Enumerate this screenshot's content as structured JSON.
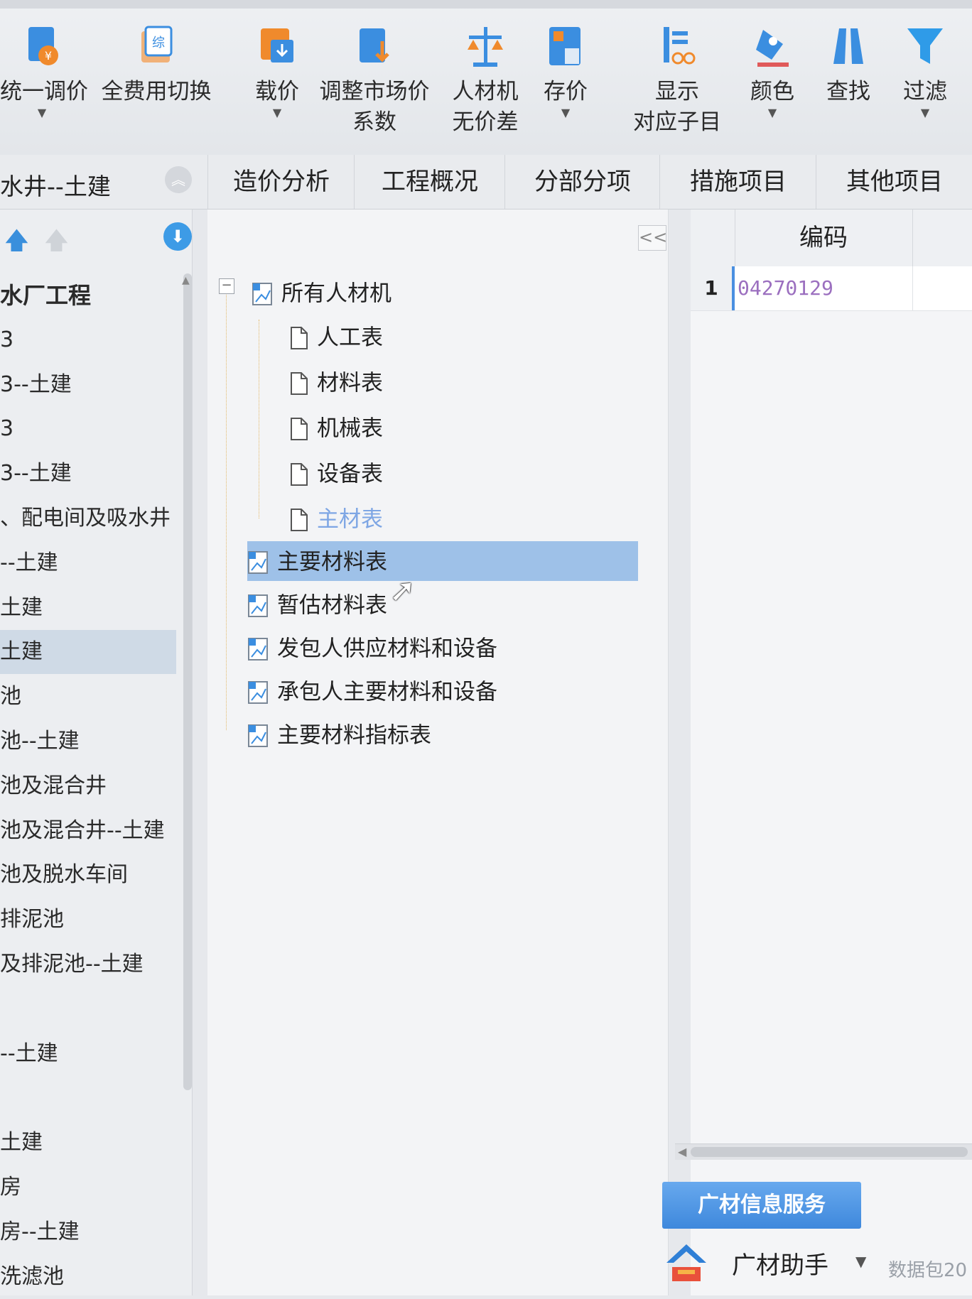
{
  "toolbar": {
    "buttons": [
      {
        "line1": "统一调价",
        "line2": "",
        "has_dropdown": true
      },
      {
        "line1": "全费用切换",
        "line2": "",
        "has_dropdown": false
      },
      {
        "line1": "载价",
        "line2": "",
        "has_dropdown": true
      },
      {
        "line1": "调整市场价",
        "line2": "系数",
        "has_dropdown": false
      },
      {
        "line1": "人材机",
        "line2": "无价差",
        "has_dropdown": false
      },
      {
        "line1": "存价",
        "line2": "",
        "has_dropdown": true
      },
      {
        "line1": "显示",
        "line2": "对应子目",
        "has_dropdown": false
      },
      {
        "line1": "颜色",
        "line2": "",
        "has_dropdown": true
      },
      {
        "line1": "查找",
        "line2": "",
        "has_dropdown": false
      },
      {
        "line1": "过滤",
        "line2": "",
        "has_dropdown": true
      }
    ]
  },
  "tabs": {
    "project_title": "水井--土建",
    "items": [
      "造价分析",
      "工程概况",
      "分部分项",
      "措施项目",
      "其他项目"
    ]
  },
  "left_panel": {
    "items": [
      {
        "label": "水厂工程",
        "root": true
      },
      {
        "label": "3"
      },
      {
        "label": "3--土建"
      },
      {
        "label": "3"
      },
      {
        "label": "3--土建"
      },
      {
        "label": "、配电间及吸水井"
      },
      {
        "label": "--土建"
      },
      {
        "label": "土建"
      },
      {
        "label": "土建",
        "selected": true
      },
      {
        "label": "池"
      },
      {
        "label": "池--土建"
      },
      {
        "label": "池及混合井"
      },
      {
        "label": "池及混合井--土建"
      },
      {
        "label": "池及脱水车间"
      },
      {
        "label": "排泥池"
      },
      {
        "label": "及排泥池--土建"
      },
      {
        "label": ""
      },
      {
        "label": "--土建"
      },
      {
        "label": ""
      },
      {
        "label": "土建"
      },
      {
        "label": "房"
      },
      {
        "label": "房--土建"
      },
      {
        "label": "洗滤池"
      }
    ]
  },
  "tree": {
    "collapse_label": "<<",
    "root": "所有人材机",
    "children": [
      "人工表",
      "材料表",
      "机械表",
      "设备表",
      "主材表"
    ],
    "others": [
      "主要材料表",
      "暂估材料表",
      "发包人供应材料和设备",
      "承包人主要材料和设备",
      "主要材料指标表"
    ],
    "selected": "主要材料表"
  },
  "grid": {
    "column_header": "编码",
    "rows": [
      {
        "row_no": "1",
        "code": "04270129"
      }
    ]
  },
  "bottom": {
    "info_button": "广材信息服务",
    "helper_label": "广材助手",
    "package_label": "数据包20"
  },
  "colors": {
    "accent": "#3d9be6",
    "selection": "#9ec1e8",
    "tree_disabled_text": "#7ea6e4",
    "code_text": "#9b6fbf"
  }
}
